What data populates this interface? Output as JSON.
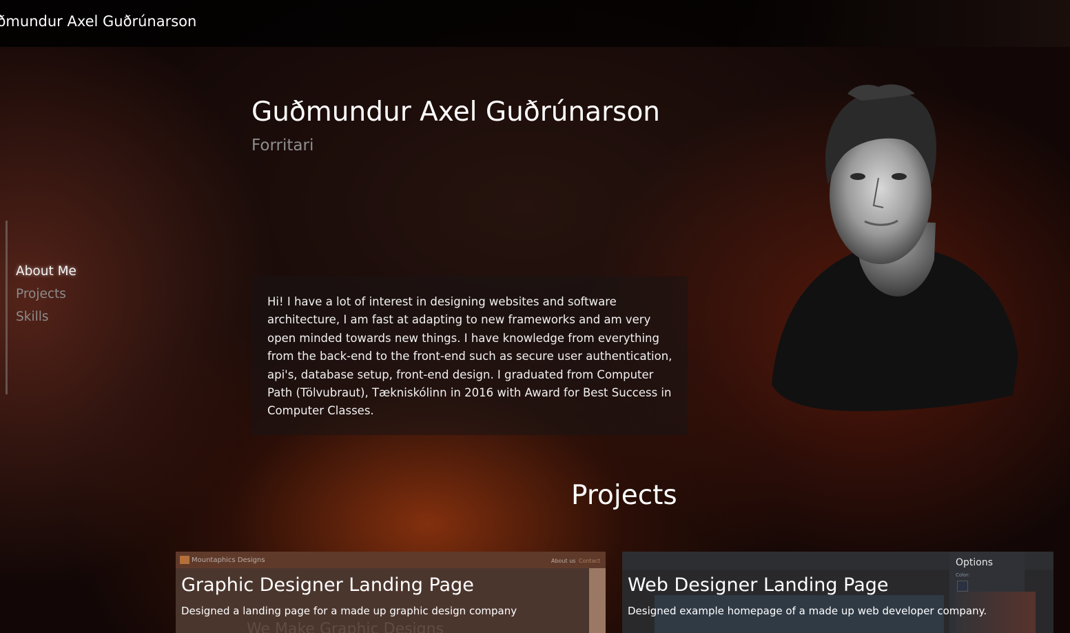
{
  "header": {
    "brand": "Guðmundur Axel Guðrúnarson"
  },
  "nav": {
    "items": [
      {
        "label": "About Me",
        "active": true
      },
      {
        "label": "Projects",
        "active": false
      },
      {
        "label": "Skills",
        "active": false
      }
    ]
  },
  "hero": {
    "name": "Guðmundur Axel Guðrúnarson",
    "subtitle": "Forritari",
    "about": "Hi! I have a lot of interest in designing websites and software architecture, I am fast at adapting to new frameworks and am very open minded towards new things. I have knowledge from everything from the back-end to the front-end such as secure user authentication, api's, database setup, front-end design. I graduated from Computer Path (Tölvubraut), Tækniskólinn in 2016 with Award for Best Success in Computer Classes."
  },
  "projects": {
    "heading": "Projects",
    "items": [
      {
        "title": "Graphic Designer Landing Page",
        "description": "Designed a landing page for a made up graphic design company",
        "screenshot": {
          "brand": "Mountaphics Designs",
          "nav": [
            "About us",
            "Contact"
          ],
          "hero": "We Make Graphic Designs"
        }
      },
      {
        "title": "Web Designer Landing Page",
        "description": "Designed example homepage of a made up web developer company.",
        "screenshot": {
          "options_label": "Options",
          "color_label": "Color:"
        }
      }
    ]
  },
  "colors": {
    "nav_active": "#f5f5f5",
    "nav_inactive": "#8c8c8c",
    "subtitle": "#8e8e8e",
    "accent_glow": "#96370f"
  }
}
